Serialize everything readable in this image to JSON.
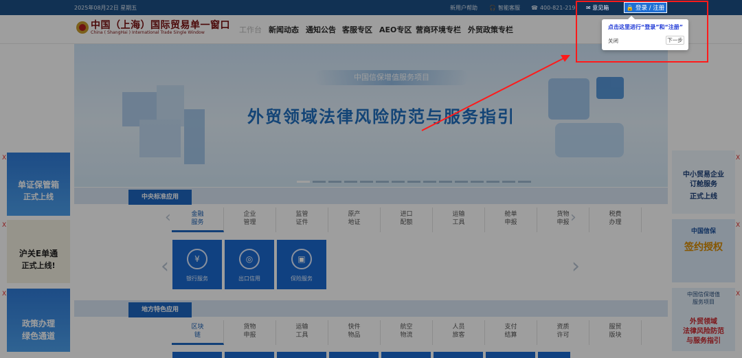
{
  "topbar": {
    "date": "2025年08月22日 星期五",
    "new_user_help": "新用户帮助",
    "smart_service": "智能客服",
    "hotline": "400-821-219",
    "feedback": "意见箱",
    "login_register": "登录 / 注册"
  },
  "header": {
    "logo_cn": "中国（上海）国际贸易单一窗口",
    "logo_en": "China ( ShangHai ) International Trade Single Window",
    "nav": [
      "工作台",
      "新闻动态",
      "通知公告",
      "客服专区",
      "AEO专区",
      "营商环境专栏",
      "外贸政策专栏"
    ]
  },
  "banner": {
    "pill": "中国信保增值服务项目",
    "headline": "外贸领域法律风险防范与服务指引"
  },
  "central": {
    "tab": "中央标准应用",
    "categories": [
      [
        "金融",
        "服务"
      ],
      [
        "企业",
        "管理"
      ],
      [
        "监管",
        "证件"
      ],
      [
        "原产",
        "地证"
      ],
      [
        "进口",
        "配额"
      ],
      [
        "运输",
        "工具"
      ],
      [
        "舱单",
        "申报"
      ],
      [
        "货物",
        "申报"
      ],
      [
        "税费",
        "办理"
      ]
    ],
    "tiles": [
      "银行服务",
      "出口信用",
      "保险服务"
    ]
  },
  "local": {
    "tab": "地方特色应用",
    "categories": [
      [
        "区块",
        "链"
      ],
      [
        "货物",
        "申报"
      ],
      [
        "运输",
        "工具"
      ],
      [
        "快件",
        "物品"
      ],
      [
        "航空",
        "物流"
      ],
      [
        "人员",
        "旅客"
      ],
      [
        "支付",
        "结算"
      ],
      [
        "资质",
        "许可"
      ],
      [
        "服贸",
        "版块"
      ]
    ]
  },
  "left_ads": [
    {
      "title": "单证保管箱",
      "sub": "正式上线"
    },
    {
      "title": "沪关E单通",
      "sub": "正式上线!"
    },
    {
      "title": "政策办理",
      "sub": "绿色通道"
    }
  ],
  "right_ads": [
    {
      "title": "中小贸易企业",
      "sub": "订舱服务",
      "extra": "正式上线"
    },
    {
      "title": "中国信保",
      "sub": "签约授权"
    },
    {
      "title": "中国信保增值",
      "sub": "服务项目",
      "extra": "外贸领域",
      "extra2": "法律风险防范",
      "extra3": "与服务指引"
    }
  ],
  "tooltip": {
    "message": "点击这里进行“登录”和“注册”",
    "close": "关闭",
    "next": "下一步"
  },
  "ad_close": "X",
  "colors": {
    "brand_blue": "#1d66c1",
    "highlight_red": "#ff1a1a",
    "tooltip_text": "#1d37d6"
  }
}
